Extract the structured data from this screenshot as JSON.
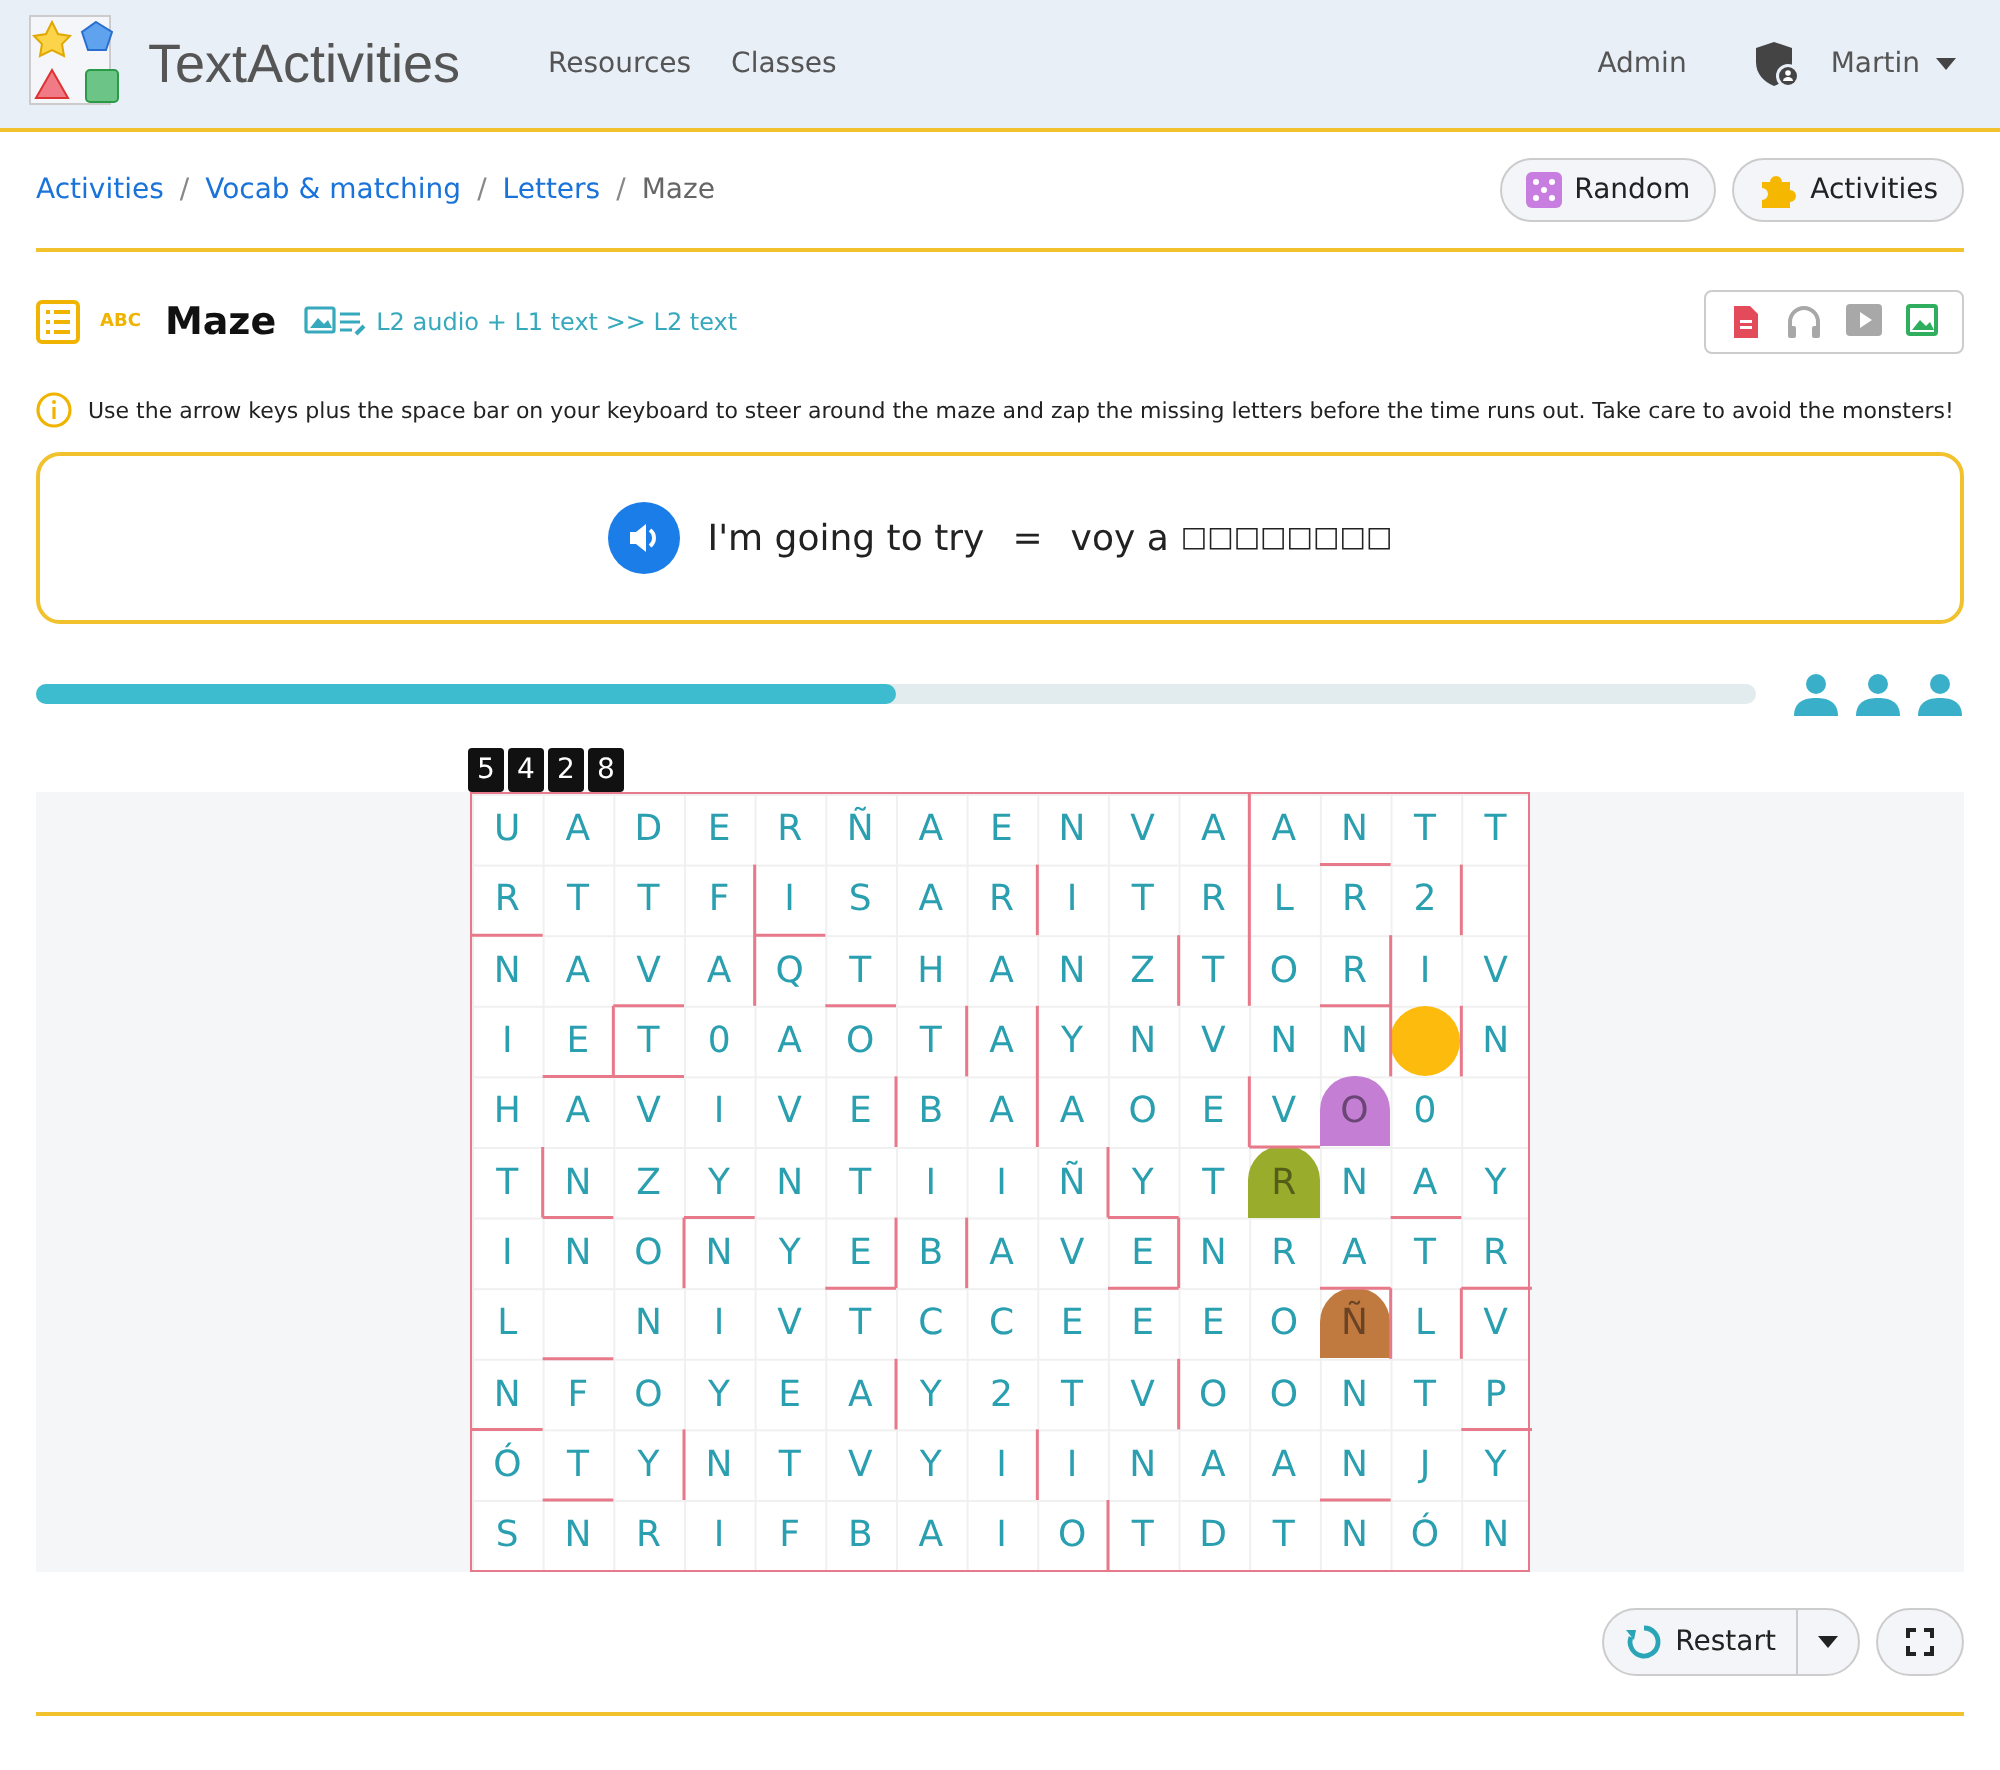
{
  "navbar": {
    "brand": "TextActivities",
    "links": [
      "Resources",
      "Classes"
    ],
    "admin": "Admin",
    "user": "Martin"
  },
  "breadcrumb": {
    "separator": "/",
    "items": [
      "Activities",
      "Vocab & matching",
      "Letters",
      "Maze"
    ]
  },
  "header_buttons": [
    {
      "kind": "random",
      "label": "Random"
    },
    {
      "kind": "activities",
      "label": "Activities"
    }
  ],
  "activity": {
    "tag": "ABC",
    "title": "Maze",
    "mode": "L2 audio + L1 text >> L2 text",
    "media": [
      {
        "kind": "document",
        "on": true
      },
      {
        "kind": "audio",
        "on": false
      },
      {
        "kind": "video",
        "on": false
      },
      {
        "kind": "image",
        "on": true
      }
    ],
    "instructions": "Use the arrow keys plus the space bar on your keyboard to steer around the maze and zap the missing letters before the time runs out. Take care to avoid the monsters!"
  },
  "prompt": {
    "source": "I'm going to try",
    "equals": "=",
    "target": "voy a",
    "blanks": "□□□□□□□□"
  },
  "progress": {
    "level": 0.5
  },
  "lives": [
    {
      "on": true
    },
    {
      "on": true
    },
    {
      "on": true
    }
  ],
  "score": [
    "5",
    "4",
    "2",
    "8"
  ],
  "maze": {
    "rows": [
      [
        "U",
        "A",
        "D",
        "E",
        "R",
        "Ñ",
        "A",
        "E",
        "N",
        "V",
        "A",
        "A",
        "N",
        "T",
        "T"
      ],
      [
        "R",
        "T",
        "T",
        "F",
        "I",
        "S",
        "A",
        "R",
        "I",
        "T",
        "R",
        "L",
        "R",
        "2",
        {
          "kind": "empty"
        }
      ],
      [
        "N",
        "A",
        "V",
        "A",
        "Q",
        "T",
        "H",
        "A",
        "N",
        "Z",
        "T",
        "O",
        "R",
        "I",
        "V"
      ],
      [
        "I",
        "E",
        "T",
        "0",
        "A",
        "O",
        "T",
        "A",
        "Y",
        "N",
        "V",
        "N",
        "N",
        {
          "kind": "player"
        },
        "N"
      ],
      [
        "H",
        "A",
        "V",
        "I",
        "V",
        "E",
        "B",
        "A",
        "A",
        "O",
        "E",
        "V",
        {
          "kind": "monster",
          "letter": "O",
          "color": "#c47fd5"
        },
        "0",
        {
          "kind": "empty"
        }
      ],
      [
        "T",
        "N",
        "Z",
        "Y",
        "N",
        "T",
        "I",
        "I",
        "Ñ",
        "Y",
        "T",
        {
          "kind": "monster",
          "letter": "R",
          "color": "#9aac2c"
        },
        "N",
        "A",
        "Y"
      ],
      [
        "I",
        "N",
        "O",
        "N",
        "Y",
        "E",
        "B",
        "A",
        "V",
        "E",
        "N",
        "R",
        "A",
        "T",
        "R"
      ],
      [
        "L",
        {
          "kind": "empty"
        },
        "N",
        "I",
        "V",
        "T",
        "C",
        "C",
        "E",
        "E",
        "E",
        "O",
        {
          "kind": "monster",
          "letter": "Ñ",
          "color": "#c07a40"
        },
        "L",
        "V"
      ],
      [
        "N",
        "F",
        "O",
        "Y",
        "E",
        "A",
        "Y",
        "2",
        "T",
        "V",
        "O",
        "O",
        "N",
        "T",
        "P"
      ],
      [
        "Ó",
        "T",
        "Y",
        "N",
        "T",
        "V",
        "Y",
        "I",
        "I",
        "N",
        "A",
        "A",
        "N",
        "J",
        "Y"
      ],
      [
        "S",
        "N",
        "R",
        "I",
        "F",
        "B",
        "A",
        "I",
        "O",
        "T",
        "D",
        "T",
        "N",
        "Ó",
        "N"
      ]
    ]
  },
  "controls": {
    "restart": "Restart"
  }
}
